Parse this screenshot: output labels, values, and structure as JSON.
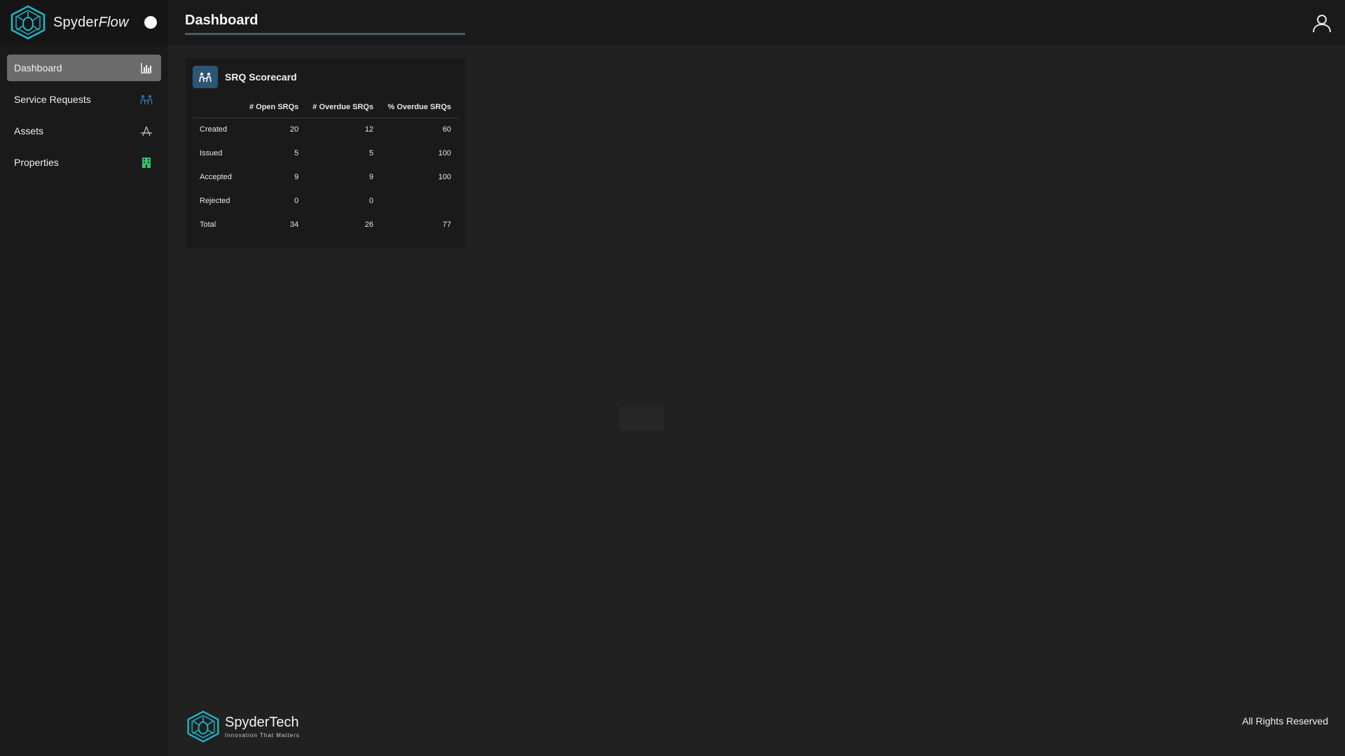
{
  "app": {
    "name_part1": "Spyder",
    "name_part2": "Flow",
    "accent": "#1fb8c9"
  },
  "sidebar": {
    "items": [
      {
        "label": "Dashboard",
        "icon": "bar-chart-icon",
        "active": true
      },
      {
        "label": "Service Requests",
        "icon": "people-icon",
        "active": false
      },
      {
        "label": "Assets",
        "icon": "asset-icon",
        "active": false
      },
      {
        "label": "Properties",
        "icon": "building-icon",
        "active": false
      }
    ]
  },
  "header": {
    "title": "Dashboard"
  },
  "scorecard": {
    "title": "SRQ Scorecard",
    "columns": [
      "",
      "# Open SRQs",
      "# Overdue SRQs",
      "% Overdue SRQs"
    ],
    "rows": [
      [
        "Created",
        "20",
        "12",
        "60"
      ],
      [
        "Issued",
        "5",
        "5",
        "100"
      ],
      [
        "Accepted",
        "9",
        "9",
        "100"
      ],
      [
        "Rejected",
        "0",
        "0",
        ""
      ],
      [
        "Total",
        "34",
        "26",
        "77"
      ]
    ]
  },
  "footer": {
    "brand": "SpyderTech",
    "tagline": "Innovation That Matters",
    "rights": "All Rights Reserved"
  }
}
